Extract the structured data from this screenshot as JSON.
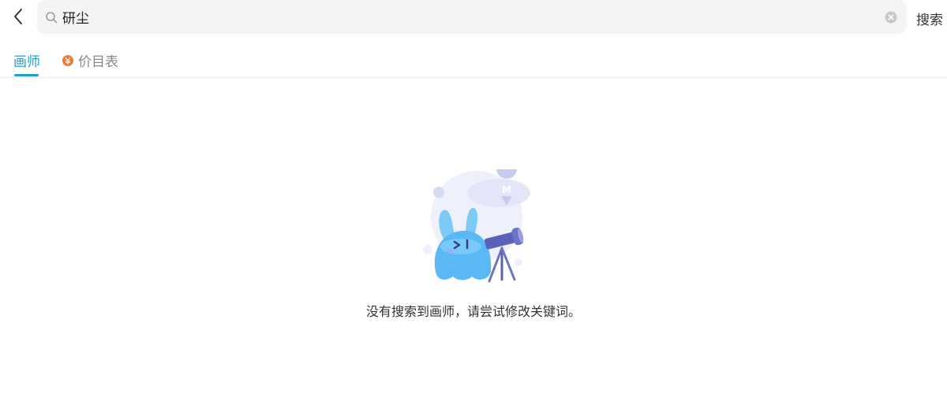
{
  "header": {
    "back_icon": "chevron-left-icon",
    "search": {
      "value": "研尘",
      "placeholder": "",
      "search_icon": "search-icon",
      "clear_icon": "clear-icon"
    },
    "search_action_label": "搜索"
  },
  "tabs": [
    {
      "label": "画师",
      "active": true
    },
    {
      "label": "价目表",
      "active": false,
      "icon": "yen-coin-icon"
    }
  ],
  "empty_state": {
    "message": "没有搜索到画师，请尝试修改关键词。",
    "illustration": "bunny-telescope-illustration",
    "badge_text": "M"
  },
  "colors": {
    "accent": "#1a9fd6",
    "tab_inactive": "#888888",
    "price_icon": "#ee7a3c",
    "search_bg": "#f4f4f4",
    "illustration_blue": "#5ab8f5",
    "illustration_purple": "#6c74c9"
  }
}
